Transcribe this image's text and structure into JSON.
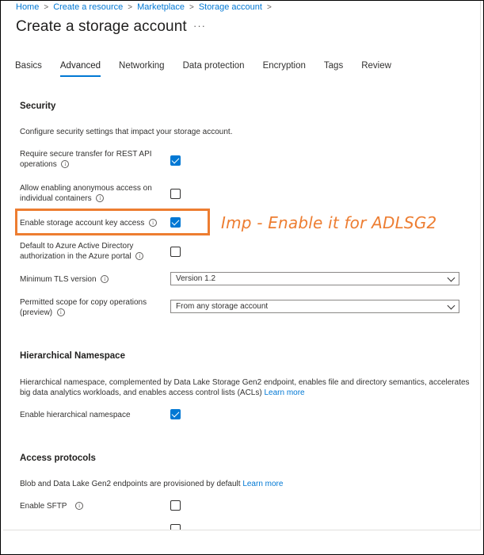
{
  "breadcrumb": [
    "Home",
    "Create a resource",
    "Marketplace",
    "Storage account"
  ],
  "page_title": "Create a storage account",
  "title_more": "···",
  "tabs": [
    {
      "label": "Basics",
      "active": false
    },
    {
      "label": "Advanced",
      "active": true
    },
    {
      "label": "Networking",
      "active": false
    },
    {
      "label": "Data protection",
      "active": false
    },
    {
      "label": "Encryption",
      "active": false
    },
    {
      "label": "Tags",
      "active": false
    },
    {
      "label": "Review",
      "active": false
    }
  ],
  "security": {
    "heading": "Security",
    "description": "Configure security settings that impact your storage account.",
    "secure_transfer": {
      "label_line1": "Require secure transfer for REST API",
      "label_line2": "operations",
      "checked": true
    },
    "anonymous_access": {
      "label_line1": "Allow enabling anonymous access on",
      "label_line2": "individual containers",
      "checked": false
    },
    "key_access": {
      "label": "Enable storage account key access",
      "checked": true
    },
    "aad_default": {
      "label_line1": "Default to Azure Active Directory",
      "label_line2": "authorization in the Azure portal",
      "checked": false
    },
    "tls": {
      "label": "Minimum TLS version",
      "value": "Version 1.2"
    },
    "copy_scope": {
      "label_line1": "Permitted scope for copy operations",
      "label_line2": "(preview)",
      "value": "From any storage account"
    }
  },
  "annotation": {
    "text": "Imp - Enable it for ADLSG2",
    "color": "#ed7d31"
  },
  "hns": {
    "heading": "Hierarchical Namespace",
    "description_line1": "Hierarchical namespace, complemented by Data Lake Storage Gen2 endpoint, enables file and directory semantics, accelerates",
    "description_line2": "big data analytics workloads, and enables access control lists (ACLs)",
    "learn_more": "Learn more",
    "enable": {
      "label": "Enable hierarchical namespace",
      "checked": true
    }
  },
  "access": {
    "heading": "Access protocols",
    "description": "Blob and Data Lake Gen2 endpoints are provisioned by default",
    "learn_more": "Learn more",
    "sftp": {
      "label": "Enable SFTP",
      "checked": false
    }
  },
  "info_icon_glyph": "i",
  "colors": {
    "accent": "#0078d4",
    "highlight": "#ed7d31"
  }
}
